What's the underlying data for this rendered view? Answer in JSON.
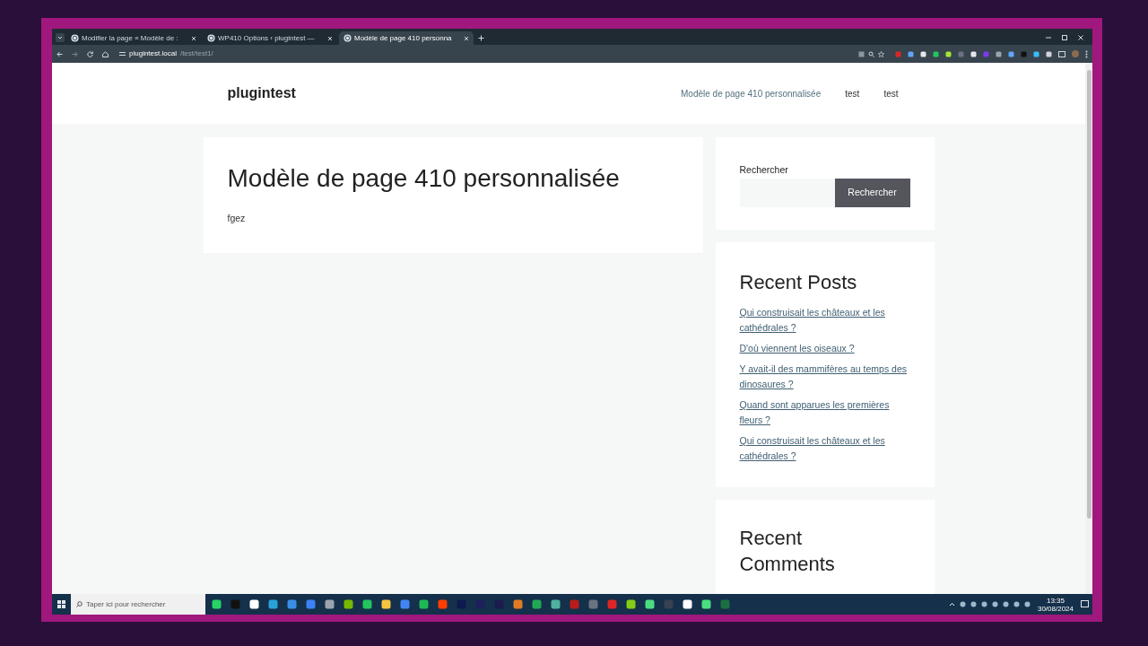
{
  "browser": {
    "tabs": [
      {
        "label": "Modifier la page « Modèle de :",
        "selected": false
      },
      {
        "label": "WP410 Options ‹ plugintest —",
        "selected": false
      },
      {
        "label": "Modèle de page 410 personna",
        "selected": true
      }
    ],
    "url": {
      "host": "plugintest.local",
      "path": "/test/test1/"
    }
  },
  "site": {
    "title": "plugintest",
    "nav": [
      "Modèle de page 410 personnalisée",
      "test",
      "test"
    ]
  },
  "main": {
    "title": "Modèle de page 410 personnalisée",
    "body": "fgez"
  },
  "sidebar": {
    "search": {
      "label": "Rechercher",
      "button": "Rechercher"
    },
    "recent_posts": {
      "title": "Recent Posts",
      "links": [
        "Qui construisait les châteaux et les cathédrales ?",
        "D'où viennent les oiseaux ?",
        "Y avait-il des mammifères au temps des dinosaures ?",
        "Quand sont apparues les premières fleurs ?",
        "Qui construisait les châteaux et les cathédrales ?"
      ]
    },
    "recent_comments": {
      "title": "Recent Comments"
    }
  },
  "taskbar": {
    "search": {
      "placeholder": "Taper ici pour rechercher"
    },
    "time": "13:35",
    "date": "30/08/2024"
  }
}
